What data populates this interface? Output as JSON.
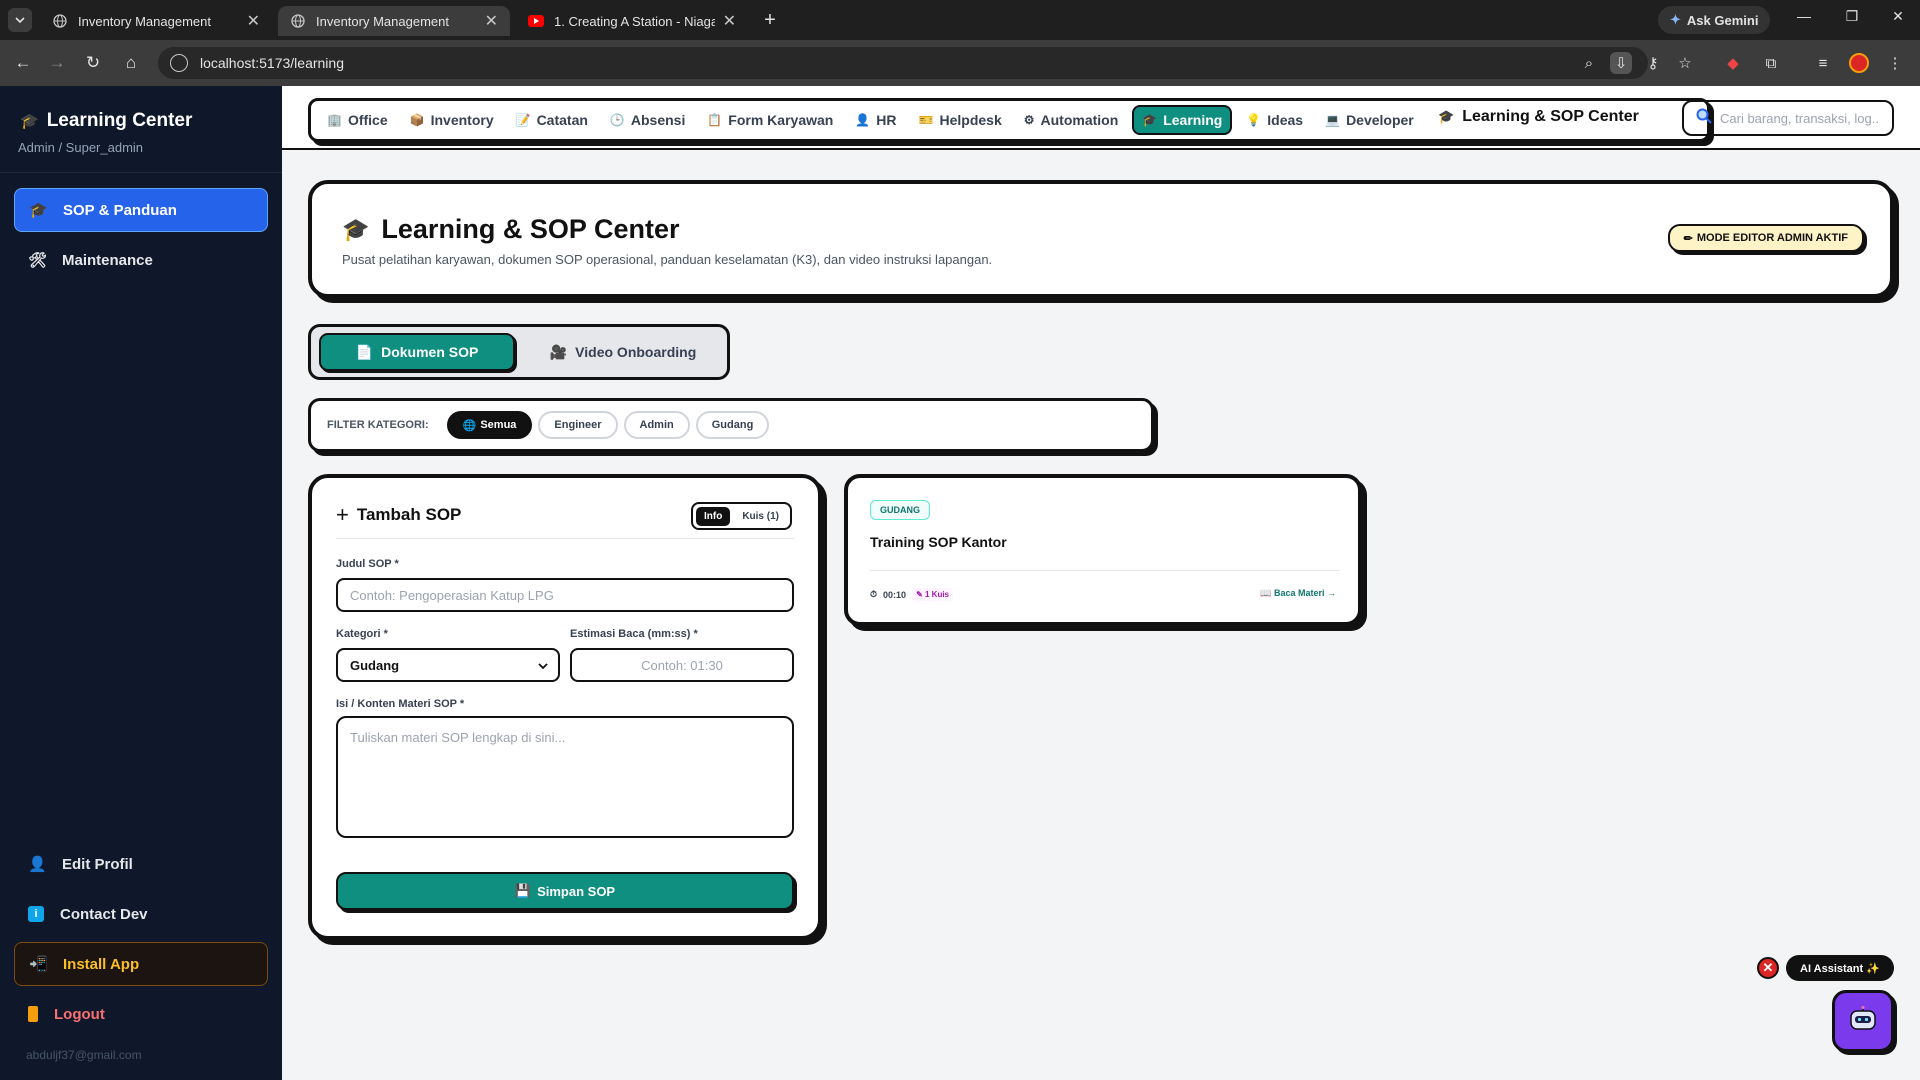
{
  "browser": {
    "tabs": [
      {
        "title": "Inventory Management",
        "active": false
      },
      {
        "title": "Inventory Management",
        "active": true
      },
      {
        "title": "1. Creating A Station - Niagara 4",
        "active": false
      }
    ],
    "ask_gemini": "Ask Gemini",
    "url": "localhost:5173/learning"
  },
  "sidebar": {
    "title": "Learning Center",
    "subtitle": "Admin / Super_admin",
    "items": [
      {
        "label": "SOP & Panduan",
        "icon": "graduation-cap-icon"
      },
      {
        "label": "Maintenance",
        "icon": "tools-icon"
      }
    ],
    "bottom_items": [
      {
        "label": "Edit Profil",
        "icon": "user-icon"
      },
      {
        "label": "Contact Dev",
        "icon": "info-icon"
      },
      {
        "label": "Install App",
        "icon": "install-icon"
      },
      {
        "label": "Logout",
        "icon": "door-icon"
      }
    ],
    "email": "abduljf37@gmail.com"
  },
  "topnav": {
    "links": [
      {
        "label": "Office",
        "icon": "office-icon"
      },
      {
        "label": "Inventory",
        "icon": "box-icon"
      },
      {
        "label": "Catatan",
        "icon": "note-icon"
      },
      {
        "label": "Absensi",
        "icon": "clock-icon"
      },
      {
        "label": "Form Karyawan",
        "icon": "clipboard-icon"
      },
      {
        "label": "HR",
        "icon": "person-icon"
      },
      {
        "label": "Helpdesk",
        "icon": "ticket-icon"
      },
      {
        "label": "Automation",
        "icon": "gear-icon"
      },
      {
        "label": "Learning",
        "icon": "graduation-cap-icon"
      },
      {
        "label": "Ideas",
        "icon": "lightbulb-icon"
      },
      {
        "label": "Developer",
        "icon": "laptop-icon"
      }
    ],
    "active": "Learning",
    "breadcrumb": "Learning & SOP Center",
    "search_placeholder": "Cari barang, transaksi, log..."
  },
  "hero": {
    "title": "Learning & SOP Center",
    "subtitle": "Pusat pelatihan karyawan, dokumen SOP operasional, panduan keselamatan (K3), dan video instruksi lapangan.",
    "badge": "MODE EDITOR ADMIN AKTIF"
  },
  "content_tabs": {
    "doc": "Dokumen SOP",
    "video": "Video Onboarding"
  },
  "filter": {
    "label": "FILTER KATEGORI:",
    "chips": [
      "Semua",
      "Engineer",
      "Admin",
      "Gudang"
    ],
    "active": "Semua"
  },
  "form": {
    "title": "Tambah SOP",
    "seg_info": "Info",
    "seg_quiz": "Kuis (1)",
    "judul_label": "Judul SOP *",
    "judul_placeholder": "Contoh: Pengoperasian Katup LPG",
    "kategori_label": "Kategori *",
    "kategori_value": "Gudang",
    "estimasi_label": "Estimasi Baca (mm:ss) *",
    "estimasi_placeholder": "Contoh: 01:30",
    "konten_label": "Isi / Konten Materi SOP *",
    "konten_placeholder": "Tuliskan materi SOP lengkap di sini...",
    "save": "Simpan SOP"
  },
  "sop_cards": [
    {
      "category": "GUDANG",
      "title": "Training SOP Kantor",
      "duration": "00:10",
      "quiz": "1 Kuis",
      "action": "Baca Materi →"
    }
  ],
  "assistant": {
    "label": "AI Assistant ✨"
  },
  "colors": {
    "accent": "#0f8f80",
    "sidebar_bg": "#0f172a",
    "active_blue": "#2563eb",
    "badge_yellow": "#fef3c7"
  }
}
